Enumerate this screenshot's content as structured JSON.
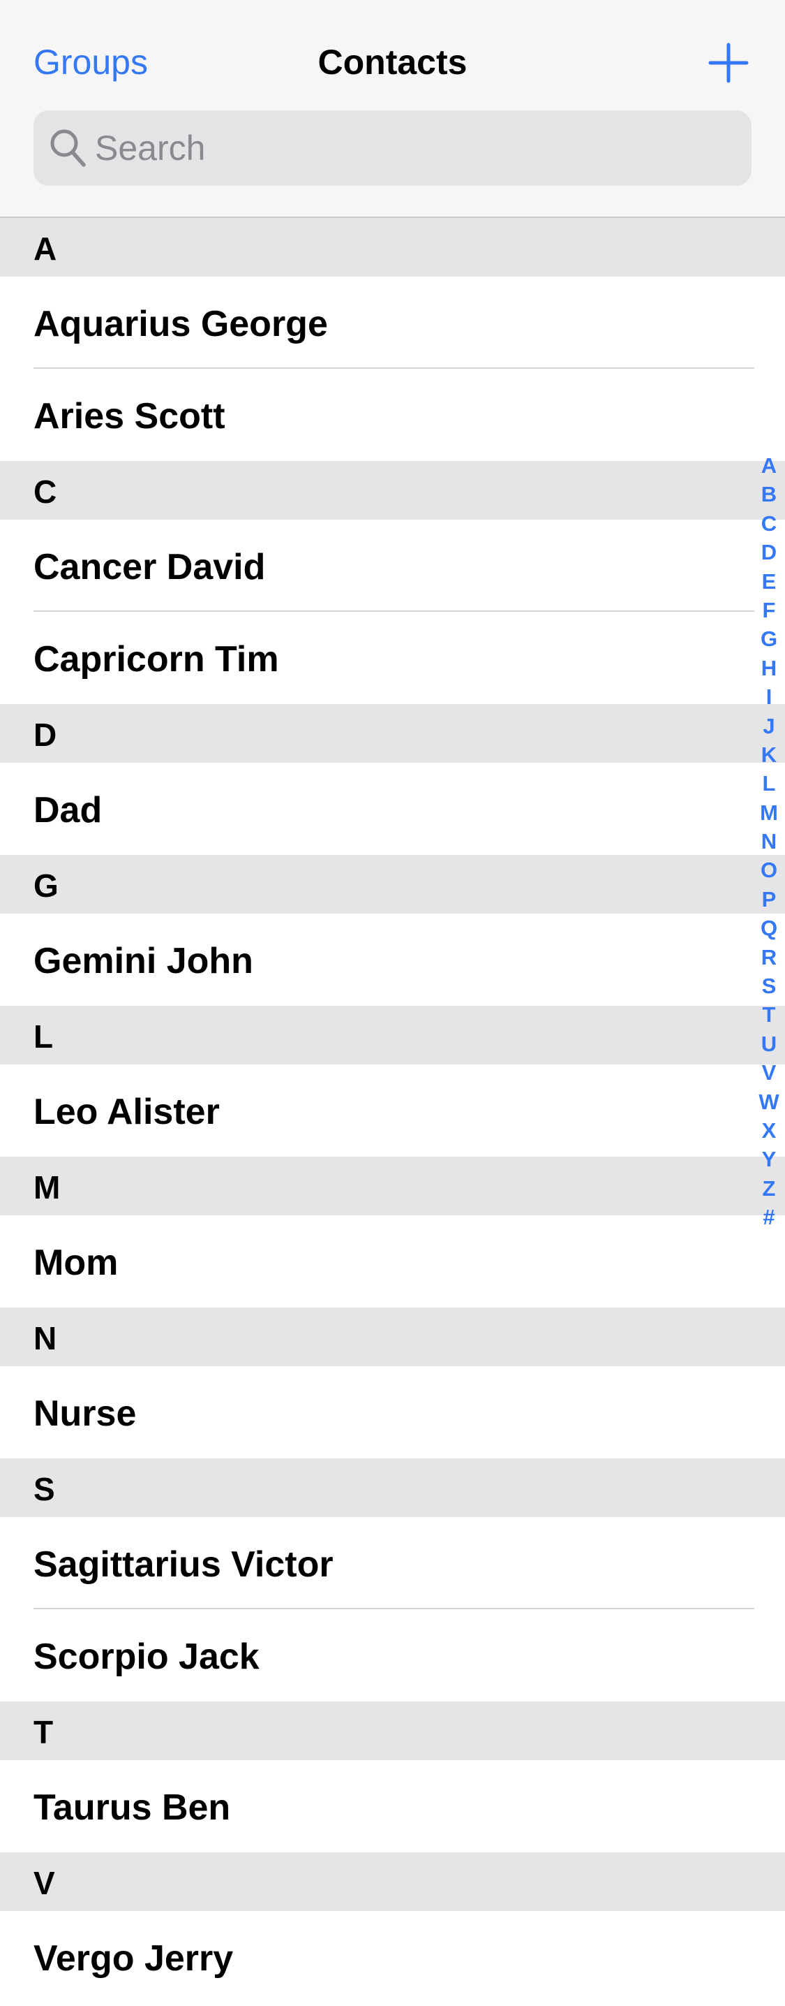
{
  "header": {
    "groups_label": "Groups",
    "title": "Contacts",
    "add_icon": "plus-icon"
  },
  "search": {
    "placeholder": "Search",
    "value": "",
    "icon": "search-icon"
  },
  "sections": [
    {
      "letter": "A",
      "contacts": [
        "Aquarius George",
        "Aries Scott"
      ]
    },
    {
      "letter": "C",
      "contacts": [
        "Cancer David",
        "Capricorn Tim"
      ]
    },
    {
      "letter": "D",
      "contacts": [
        "Dad"
      ]
    },
    {
      "letter": "G",
      "contacts": [
        "Gemini John"
      ]
    },
    {
      "letter": "L",
      "contacts": [
        "Leo Alister"
      ]
    },
    {
      "letter": "M",
      "contacts": [
        "Mom"
      ]
    },
    {
      "letter": "N",
      "contacts": [
        "Nurse"
      ]
    },
    {
      "letter": "S",
      "contacts": [
        "Sagittarius Victor",
        "Scorpio Jack"
      ]
    },
    {
      "letter": "T",
      "contacts": [
        "Taurus Ben"
      ]
    },
    {
      "letter": "V",
      "contacts": [
        "Vergo Jerry"
      ]
    }
  ],
  "index_letters": [
    "A",
    "B",
    "C",
    "D",
    "E",
    "F",
    "G",
    "H",
    "I",
    "J",
    "K",
    "L",
    "M",
    "N",
    "O",
    "P",
    "Q",
    "R",
    "S",
    "T",
    "U",
    "V",
    "W",
    "X",
    "Y",
    "Z",
    "#"
  ],
  "colors": {
    "accent": "#3478f6",
    "section_background": "#e5e5e7",
    "header_background": "#f6f6f7"
  }
}
